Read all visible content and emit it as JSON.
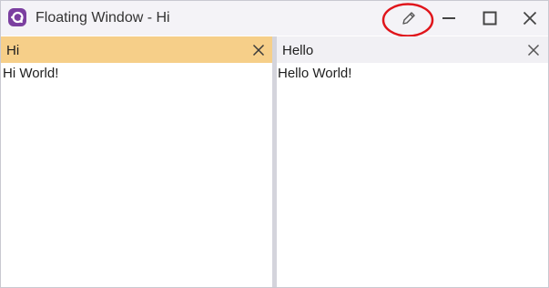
{
  "window": {
    "title": "Floating Window - Hi",
    "icons": {
      "app": "app-logo-icon",
      "edit": "pencil-icon",
      "minimize": "minimize-icon",
      "maximize": "maximize-icon",
      "close": "close-icon"
    }
  },
  "panes": [
    {
      "tab_label": "Hi",
      "content": "Hi World!",
      "active": true
    },
    {
      "tab_label": "Hello",
      "content": "Hello World!",
      "active": false
    }
  ],
  "colors": {
    "titlebar_bg": "#f4f3f7",
    "active_tab_bg": "#f6cf89",
    "inactive_tab_bg": "#f1f0f4",
    "logo_accent": "#7b3fa0",
    "highlight_annotation": "#e0151b"
  }
}
